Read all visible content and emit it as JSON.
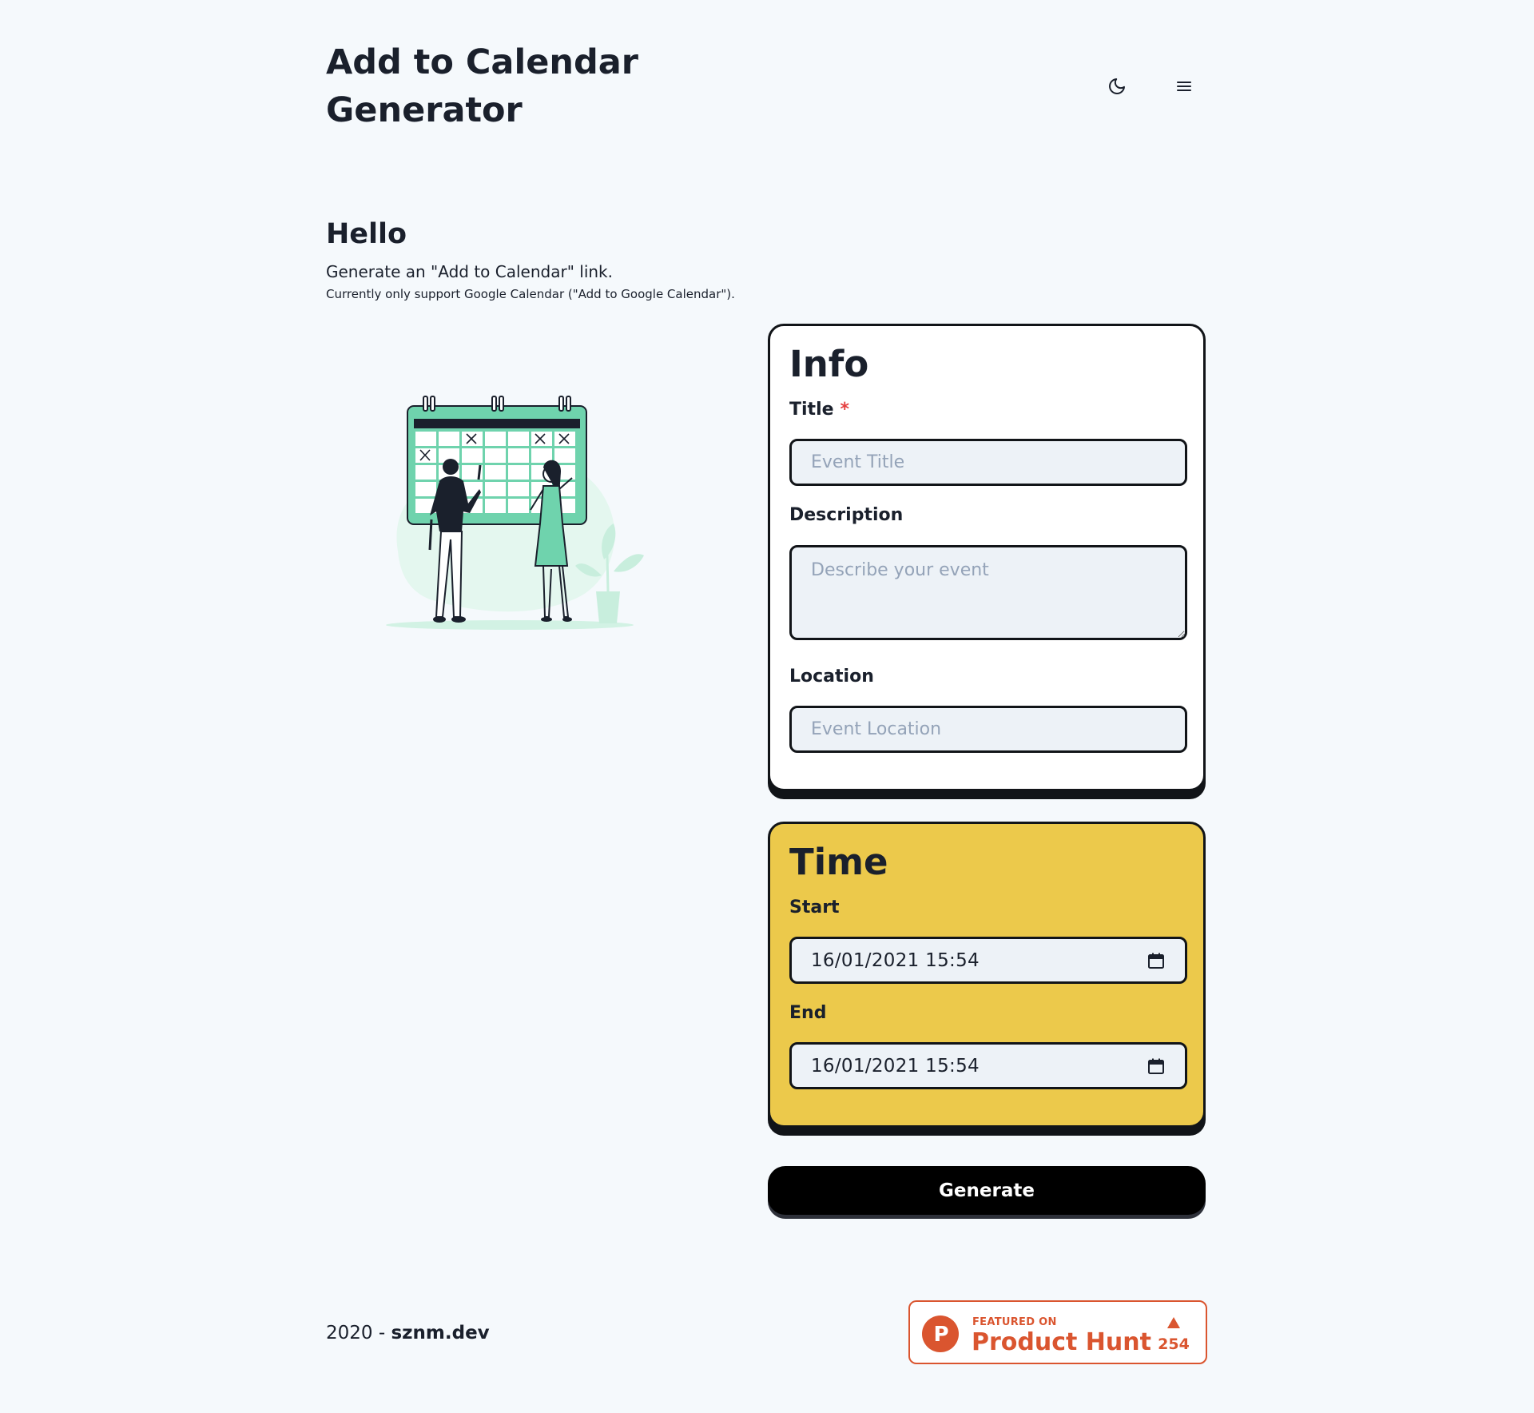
{
  "header": {
    "title": "Add to Calendar Generator",
    "theme_toggle_icon": "moon-icon",
    "menu_icon": "hamburger-menu-icon"
  },
  "intro": {
    "heading": "Hello",
    "description": "Generate an \"Add to Calendar\" link.",
    "note": "Currently only support Google Calendar (\"Add to Google Calendar\")."
  },
  "illustration": {
    "icon": "calendar-planning-illustration",
    "accent_color": "#6fd3ad"
  },
  "info_card": {
    "heading": "Info",
    "title_label": "Title",
    "title_required_mark": "*",
    "title_placeholder": "Event Title",
    "title_value": "",
    "description_label": "Description",
    "description_placeholder": "Describe your event",
    "description_value": "",
    "location_label": "Location",
    "location_placeholder": "Event Location",
    "location_value": ""
  },
  "time_card": {
    "heading": "Time",
    "start_label": "Start",
    "start_value": "16/01/2021 15:54",
    "end_label": "End",
    "end_value": "16/01/2021 15:54",
    "picker_icon": "calendar-icon",
    "background_color": "#ecc94b"
  },
  "actions": {
    "generate_label": "Generate"
  },
  "footer": {
    "year_text": "2020 - ",
    "site_link": "sznm.dev"
  },
  "product_hunt": {
    "featured_text": "FEATURED ON",
    "name": "Product Hunt",
    "upvotes": "254",
    "brand_color": "#da552f",
    "logo_letter": "P",
    "upvote_icon": "triangle-up-icon"
  },
  "colors": {
    "background": "#f5f9fc",
    "text": "#1a202c",
    "border": "#111418",
    "input_bg": "#edf2f7",
    "required": "#e53e3e"
  }
}
